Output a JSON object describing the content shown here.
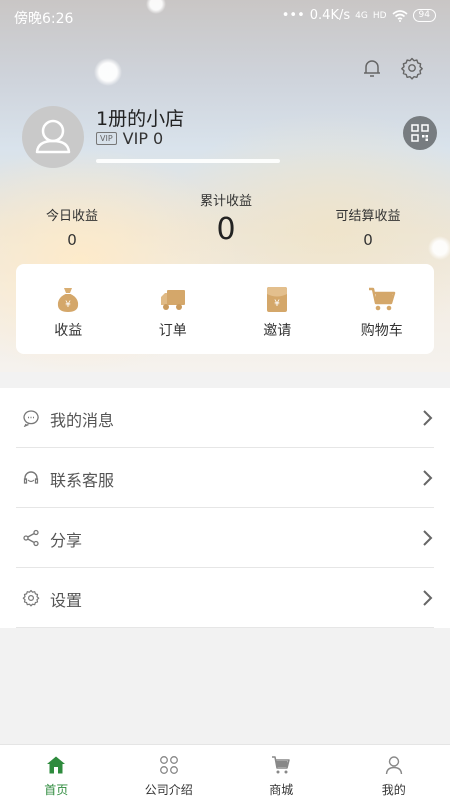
{
  "status_bar": {
    "time": "傍晚6:26",
    "network_speed": "0.4K/s",
    "signal_1": "4G",
    "signal_2": "HD",
    "battery": "94"
  },
  "header": {
    "notification_icon": "bell-icon",
    "settings_icon": "gear-icon"
  },
  "profile": {
    "shop_name": "1册的小店",
    "vip_badge": "VIP",
    "vip_level": "VIP 0",
    "qr_icon": "qr-code-icon"
  },
  "earnings": {
    "today_label": "今日收益",
    "today_value": "0",
    "total_label": "累计收益",
    "total_value": "0",
    "settle_label": "可结算收益",
    "settle_value": "0"
  },
  "shortcuts": [
    {
      "label": "收益",
      "icon": "money-bag-icon"
    },
    {
      "label": "订单",
      "icon": "truck-icon"
    },
    {
      "label": "邀请",
      "icon": "red-envelope-icon"
    },
    {
      "label": "购物车",
      "icon": "shopping-cart-icon"
    }
  ],
  "menu": [
    {
      "label": "我的消息",
      "icon": "message-icon"
    },
    {
      "label": "联系客服",
      "icon": "headset-icon"
    },
    {
      "label": "分享",
      "icon": "share-icon"
    },
    {
      "label": "设置",
      "icon": "gear-icon"
    }
  ],
  "bottom_nav": [
    {
      "label": "首页",
      "icon": "home-icon",
      "active": true
    },
    {
      "label": "公司介绍",
      "icon": "apps-icon",
      "active": false
    },
    {
      "label": "商城",
      "icon": "cart-icon",
      "active": false
    },
    {
      "label": "我的",
      "icon": "user-icon",
      "active": false
    }
  ],
  "colors": {
    "accent_green": "#2e8b3d",
    "icon_gold": "#d4a76a",
    "qr_button": "#777c80"
  }
}
